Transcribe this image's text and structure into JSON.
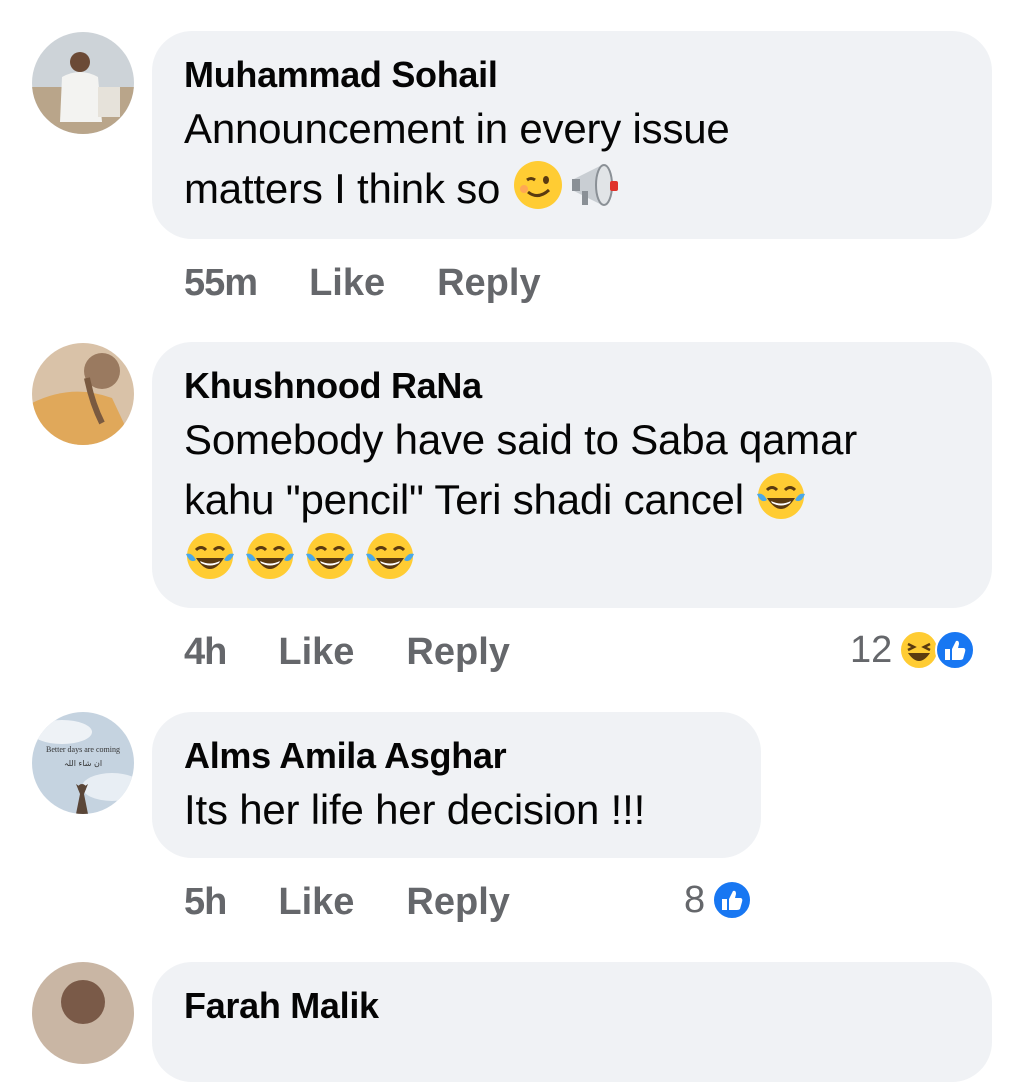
{
  "comments": [
    {
      "name": "Muhammad Sohail",
      "text_line1": "Announcement in every issue",
      "text_line2": "matters I think so",
      "emojis": [
        "winking-face",
        "megaphone"
      ],
      "time": "55m",
      "like_label": "Like",
      "reply_label": "Reply"
    },
    {
      "name": "Khushnood RaNa",
      "text_line1": "Somebody have said to Saba qamar",
      "text_line2": "kahu \"pencil\" Teri shadi cancel",
      "emojis": [
        "tears-of-joy-face",
        "tears-of-joy-face",
        "tears-of-joy-face",
        "tears-of-joy-face",
        "tears-of-joy-face"
      ],
      "time": "4h",
      "like_label": "Like",
      "reply_label": "Reply",
      "reaction_count": "12",
      "reaction_icons": [
        "haha-reaction",
        "like-reaction"
      ]
    },
    {
      "name": "Alms Amila Asghar",
      "text": "Its her life her decision !!!",
      "time": "5h",
      "like_label": "Like",
      "reply_label": "Reply",
      "reaction_count": "8",
      "reaction_icons": [
        "like-reaction"
      ],
      "avatar_text_line1": "Better days are coming",
      "avatar_text_line2": "ان شاء اللہ"
    },
    {
      "name": "Farah Malik"
    }
  ],
  "colors": {
    "bubble": "#f0f2f5",
    "meta": "#65676b",
    "like_blue": "#1877f2",
    "emoji_yellow": "#ffcc33"
  }
}
